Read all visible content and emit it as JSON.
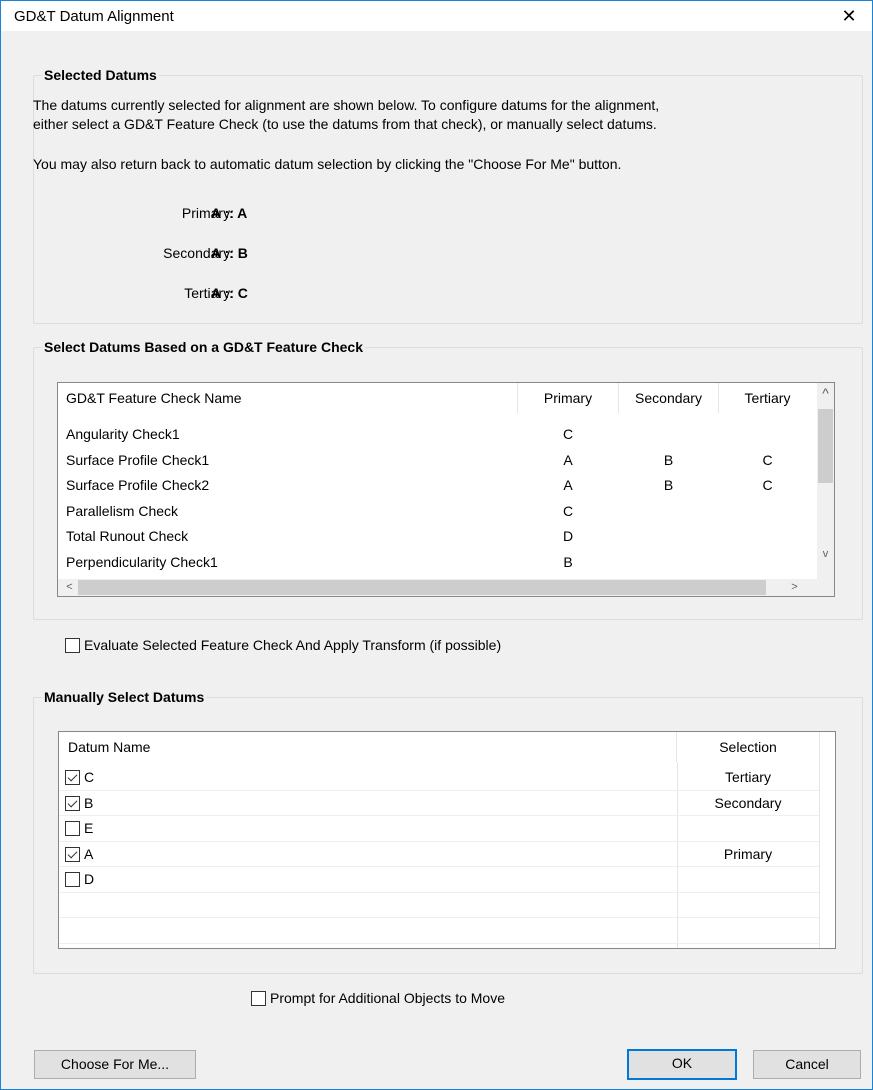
{
  "window": {
    "title": "GD&T Datum Alignment",
    "close_glyph": "✕"
  },
  "selected_datums": {
    "legend": "Selected Datums",
    "desc_line1": "The datums currently selected for alignment are shown below.  To configure datums for the alignment,",
    "desc_line2": "either select a GD&T Feature Check (to use the datums from that check), or manually select datums.",
    "desc_line3": "You may also return back to automatic datum selection by clicking the \"Choose For Me\" button.",
    "primary_label": "Primary:",
    "primary_value": "A :: A",
    "secondary_label": "Secondary:",
    "secondary_value": "A :: B",
    "tertiary_label": "Tertiary:",
    "tertiary_value": "A :: C"
  },
  "feature_check": {
    "legend": "Select Datums Based on a GD&T Feature Check",
    "columns": [
      "GD&T Feature Check Name",
      "Primary",
      "Secondary",
      "Tertiary"
    ],
    "rows": [
      {
        "name": "Angularity Check1",
        "primary": "C",
        "secondary": "",
        "tertiary": ""
      },
      {
        "name": "Surface Profile Check1",
        "primary": "A",
        "secondary": "B",
        "tertiary": "C"
      },
      {
        "name": "Surface Profile Check2",
        "primary": "A",
        "secondary": "B",
        "tertiary": "C"
      },
      {
        "name": "Parallelism Check",
        "primary": "C",
        "secondary": "",
        "tertiary": ""
      },
      {
        "name": "Total Runout Check",
        "primary": "D",
        "secondary": "",
        "tertiary": ""
      },
      {
        "name": "Perpendicularity Check1",
        "primary": "B",
        "secondary": "",
        "tertiary": ""
      }
    ],
    "scroll_up": "^",
    "scroll_down": "v",
    "scroll_left": "<",
    "scroll_right": ">"
  },
  "evaluate_checkbox": {
    "label": "Evaluate Selected Feature Check And Apply Transform (if possible)",
    "checked": false
  },
  "manual": {
    "legend": "Manually Select Datums",
    "columns": [
      "Datum Name",
      "Selection"
    ],
    "rows": [
      {
        "name": "C",
        "checked": true,
        "selection": "Tertiary"
      },
      {
        "name": "B",
        "checked": true,
        "selection": "Secondary"
      },
      {
        "name": "E",
        "checked": false,
        "selection": ""
      },
      {
        "name": "A",
        "checked": true,
        "selection": "Primary"
      },
      {
        "name": "D",
        "checked": false,
        "selection": ""
      }
    ]
  },
  "prompt_checkbox": {
    "label": "Prompt for Additional Objects to Move",
    "checked": false
  },
  "buttons": {
    "choose": "Choose For Me...",
    "ok": "OK",
    "cancel": "Cancel"
  },
  "colors": {
    "accent": "#0078d7",
    "window_border": "#1883d7"
  }
}
